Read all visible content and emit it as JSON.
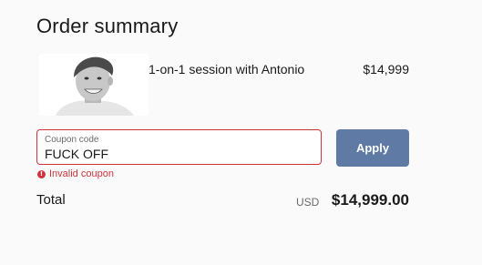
{
  "summary": {
    "title": "Order summary"
  },
  "item": {
    "name": "1-on-1 session with Antonio",
    "price": "$14,999",
    "image_alt": "Antonio portrait"
  },
  "coupon": {
    "label": "Coupon code",
    "value": "FUCK OFF",
    "apply_label": "Apply",
    "error": "Invalid coupon",
    "error_icon": "!"
  },
  "total": {
    "label": "Total",
    "currency": "USD",
    "amount": "$14,999.00"
  },
  "colors": {
    "error": "#d0343a",
    "button": "#5f7ba5",
    "background": "#fafafa"
  }
}
